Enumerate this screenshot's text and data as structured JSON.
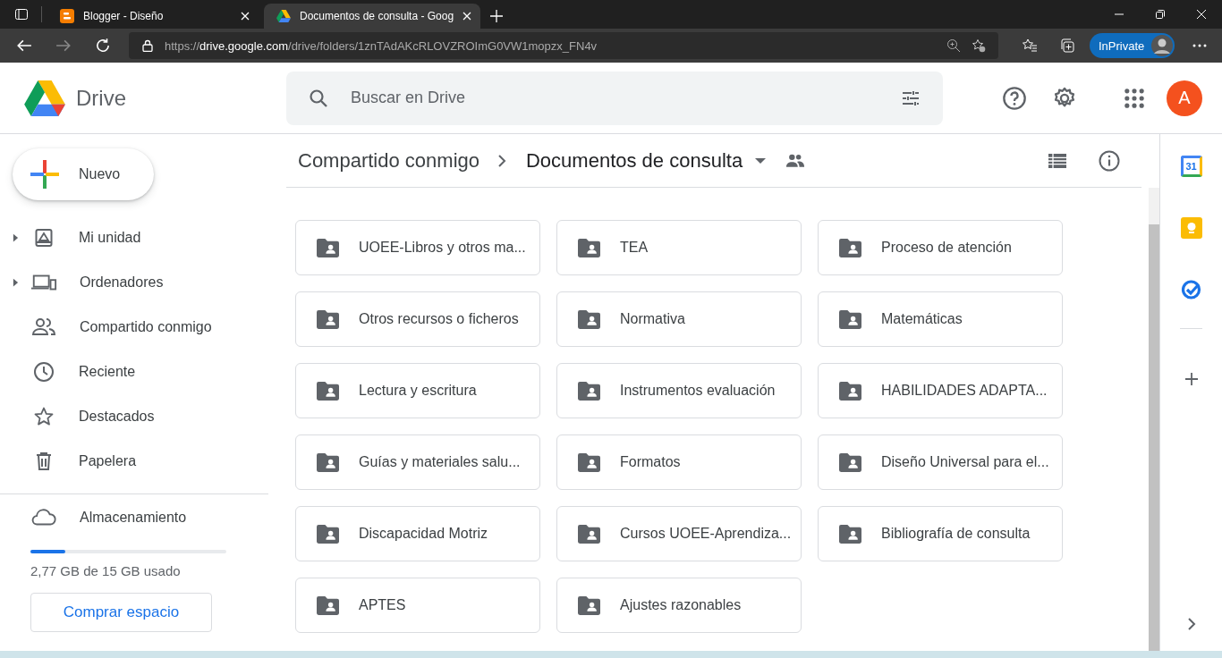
{
  "browser": {
    "tabs": [
      {
        "title": "Blogger - Diseño",
        "kind": "blogger",
        "selected": false
      },
      {
        "title": "Documentos de consulta - Goog",
        "kind": "drive",
        "selected": true
      }
    ],
    "url_host": "https://drive.google.com",
    "url_path": "/drive/folders/1znTAdAKcRLOVZROImG0VW1mopzx_FN4v",
    "inprivate": "InPrivate"
  },
  "app": {
    "name": "Drive",
    "search": {
      "placeholder": "Buscar en Drive"
    },
    "avatar": "A"
  },
  "new_button": "Nuevo",
  "sidebar": {
    "items": [
      {
        "label": "Mi unidad",
        "kind": "drive",
        "expandable": true,
        "selected": false
      },
      {
        "label": "Ordenadores",
        "kind": "computers",
        "expandable": true,
        "selected": false
      },
      {
        "label": "Compartido conmigo",
        "kind": "shared",
        "expandable": false,
        "selected": false
      },
      {
        "label": "Reciente",
        "kind": "recent",
        "expandable": false,
        "selected": false
      },
      {
        "label": "Destacados",
        "kind": "star",
        "expandable": false,
        "selected": false
      },
      {
        "label": "Papelera",
        "kind": "trash",
        "expandable": false,
        "selected": false
      }
    ],
    "storage": {
      "label": "Almacenamiento",
      "usage": "2,77 GB de 15 GB usado",
      "level": 0.18,
      "buy": "Comprar espacio"
    }
  },
  "breadcrumb": [
    {
      "label": "Compartido conmigo",
      "current": false
    },
    {
      "label": "Documentos de consulta",
      "current": true
    }
  ],
  "folders": [
    {
      "name": "UOEE-Libros y otros ma..."
    },
    {
      "name": "TEA"
    },
    {
      "name": "Proceso de atención"
    },
    {
      "name": "Otros recursos o ficheros"
    },
    {
      "name": "Normativa"
    },
    {
      "name": "Matemáticas"
    },
    {
      "name": "Lectura y escritura"
    },
    {
      "name": "Instrumentos evaluación"
    },
    {
      "name": "HABILIDADES ADAPTA..."
    },
    {
      "name": "Guías y materiales salu..."
    },
    {
      "name": "Formatos"
    },
    {
      "name": "Diseño Universal para el..."
    },
    {
      "name": "Discapacidad Motriz"
    },
    {
      "name": "Cursos UOEE-Aprendiza..."
    },
    {
      "name": "Bibliografía de consulta"
    },
    {
      "name": "APTES"
    },
    {
      "name": "Ajustes razonables"
    }
  ],
  "side_panel": {
    "calendar_day": "31"
  }
}
